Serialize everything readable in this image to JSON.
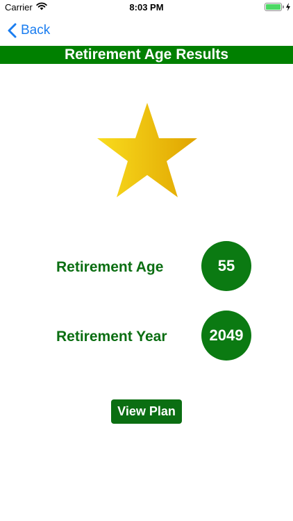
{
  "status_bar": {
    "carrier": "Carrier",
    "time": "8:03 PM",
    "wifi_icon": "wifi-icon",
    "battery_icon": "battery-icon",
    "charging_icon": "bolt-icon",
    "battery_level": 1.0
  },
  "nav": {
    "back_label": "Back",
    "back_icon": "chevron-left-icon",
    "accent_color": "#1a7df0"
  },
  "header": {
    "title": "Retirement Age Results",
    "color": "#008000"
  },
  "hero": {
    "icon": "star-icon",
    "colors": [
      "#f7d21a",
      "#e0a600"
    ]
  },
  "results": {
    "age_label": "Retirement Age",
    "age_value": "55",
    "year_label": "Retirement Year",
    "year_value": "2049",
    "label_color": "#0b6e12",
    "circle_color": "#0b7a12"
  },
  "actions": {
    "view_plan_label": "View Plan"
  }
}
